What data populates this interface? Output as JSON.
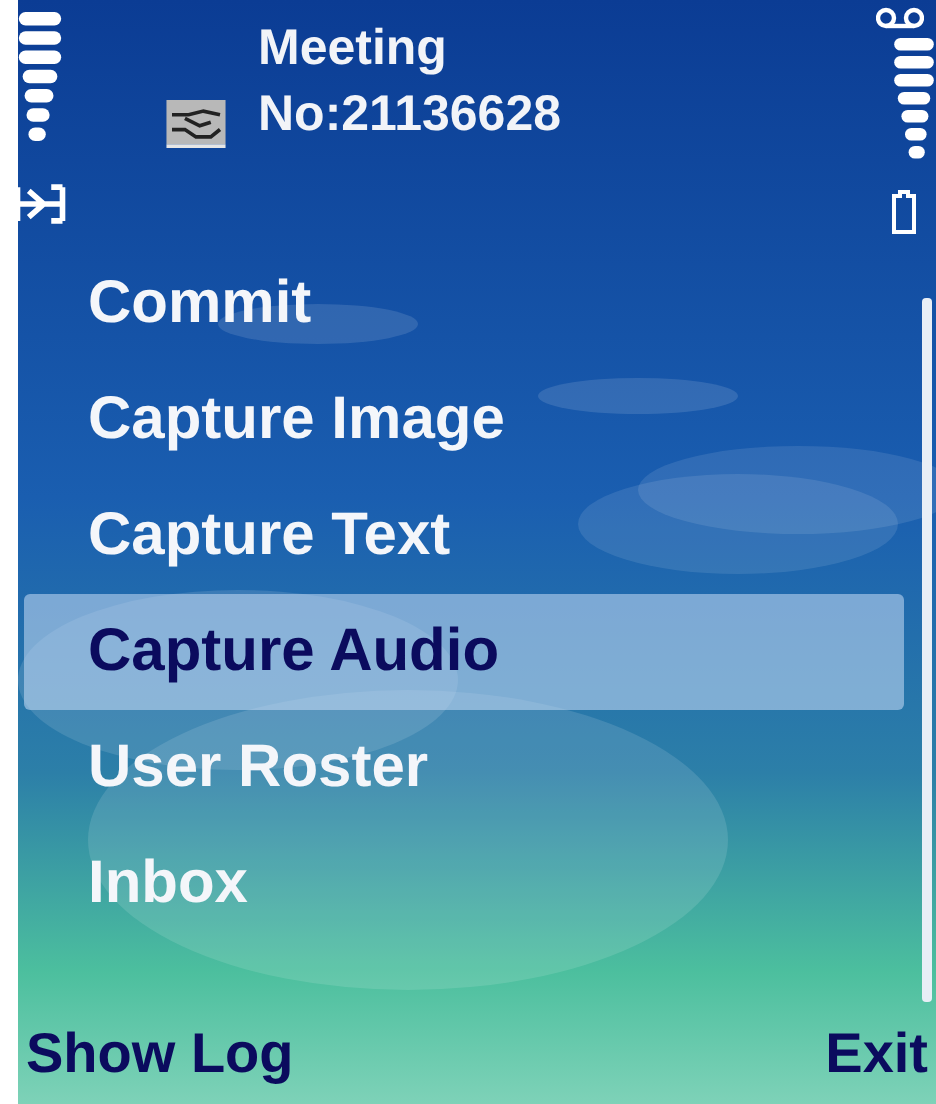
{
  "header": {
    "title_lines": [
      "Meeting",
      "No:21136628"
    ]
  },
  "menu": {
    "items": [
      {
        "label": "Commit",
        "selected": false
      },
      {
        "label": "Capture Image",
        "selected": false
      },
      {
        "label": "Capture Text",
        "selected": false
      },
      {
        "label": "Capture Audio",
        "selected": true
      },
      {
        "label": "User Roster",
        "selected": false
      },
      {
        "label": "Inbox",
        "selected": false
      }
    ]
  },
  "softkeys": {
    "left": "Show Log",
    "right": "Exit"
  }
}
